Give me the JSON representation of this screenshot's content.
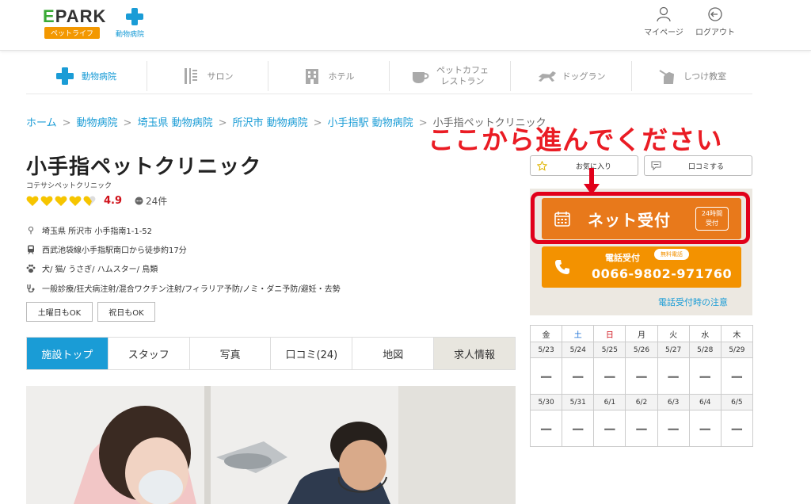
{
  "header": {
    "logo_main": "PARK",
    "logo_e": "E",
    "logo_sub": "ペットライフ",
    "logo_sub2": "動物病院",
    "mypage": "マイページ",
    "logout": "ログアウト"
  },
  "categories": [
    {
      "label": "動物病院",
      "icon": "medical-cross-icon"
    },
    {
      "label": "サロン",
      "icon": "scissors-comb-icon"
    },
    {
      "label": "ホテル",
      "icon": "building-icon"
    },
    {
      "label_line1": "ペットカフェ",
      "label_line2": "レストラン",
      "icon": "cup-icon"
    },
    {
      "label": "ドッグラン",
      "icon": "running-dog-icon"
    },
    {
      "label": "しつけ教室",
      "icon": "dog-training-icon"
    }
  ],
  "breadcrumb": [
    "ホーム",
    "動物病院",
    "埼玉県 動物病院",
    "所沢市 動物病院",
    "小手指駅 動物病院",
    "小手指ペットクリニック"
  ],
  "breadcrumb_sep": ">",
  "annotation": "ここから進んでください",
  "clinic": {
    "name": "小手指ペットクリニック",
    "kana": "コテサシペットクリニック",
    "score": "4.9",
    "reviews": "24件",
    "address": "埼玉県 所沢市 小手指南1-1-52",
    "access": "西武池袋線小手指駅南口から徒歩約17分",
    "animals": "犬/ 猫/ うさぎ/ ハムスター/ 鳥類",
    "services": "一般診療/狂犬病注射/混合ワクチン注射/フィラリア予防/ノミ・ダニ予防/避妊・去勢",
    "tags": [
      "土曜日もOK",
      "祝日もOK"
    ]
  },
  "tabs": [
    "施設トップ",
    "スタッフ",
    "写真",
    "口コミ(24)",
    "地図",
    "求人情報"
  ],
  "side": {
    "favorite": "お気に入り",
    "review": "口コミする",
    "net_reserve": "ネット受付",
    "badge_line1": "24時間",
    "badge_line2": "受付",
    "tel_label": "電話受付",
    "tel_free": "無料電話",
    "tel_number": "0066-9802-971760",
    "tel_note": "電話受付時の注意"
  },
  "calendar": {
    "dow": [
      "金",
      "土",
      "日",
      "月",
      "火",
      "水",
      "木"
    ],
    "week1": [
      "5/23",
      "5/24",
      "5/25",
      "5/26",
      "5/27",
      "5/28",
      "5/29"
    ],
    "week2": [
      "5/30",
      "5/31",
      "6/1",
      "6/2",
      "6/3",
      "6/4",
      "6/5"
    ],
    "slot": "ー"
  },
  "colors": {
    "accent": "#1a9cd6",
    "reserve": "#e8791b",
    "tel": "#f39200",
    "annotation_red": "#e1001a"
  }
}
